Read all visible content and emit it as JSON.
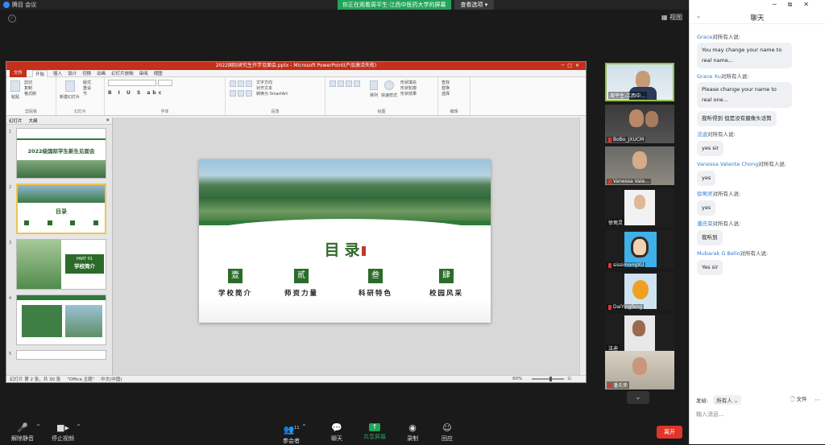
{
  "window": {
    "app_title": "腾目 会议",
    "share_notice": "你正在观看周平生-江西中医药大学的屏幕",
    "view_options": "查看选项",
    "view_label": "视图"
  },
  "ppt": {
    "title": "2022国际研究生开学见面会.pptx - Microsoft PowerPoint(产品激活失败)",
    "tabs": [
      "文件",
      "开始",
      "插入",
      "设计",
      "切换",
      "动画",
      "幻灯片放映",
      "审阅",
      "视图"
    ],
    "active_tab": "开始",
    "ribbon_groups": [
      "剪贴板",
      "幻灯片",
      "字体",
      "段落",
      "绘图",
      "编辑"
    ],
    "ribbon_labels": {
      "paste": "粘贴",
      "cut": "剪切",
      "copy": "复制",
      "format_painter": "格式刷",
      "new_slide": "新建幻灯片",
      "layout": "版式",
      "reset": "重设",
      "section": "节",
      "text_direction": "文字方向",
      "align_text": "对齐文本",
      "smartart": "转换为 SmartArt",
      "arrange": "排列",
      "quick_styles": "快速样式",
      "shape_fill": "形状填充",
      "shape_outline": "形状轮廓",
      "shape_effects": "形状效果",
      "find": "查找",
      "replace": "替换",
      "select": "选择"
    },
    "panel_tabs": [
      "幻灯片",
      "大纲"
    ],
    "thumbs": [
      {
        "num": "1",
        "title": "2022级国际学生新生见面会"
      },
      {
        "num": "2",
        "title": "目录"
      },
      {
        "num": "3",
        "title": "学校简介",
        "part": "PART 01"
      },
      {
        "num": "4",
        "title": ""
      },
      {
        "num": "5",
        "title": ""
      }
    ],
    "status": {
      "slide_pos": "幻灯片 第 2 张，共 30 张",
      "theme": "\"Office 主题\"",
      "lang": "中文(中国)",
      "zoom": "60%"
    },
    "slide": {
      "heading": "目录",
      "items": [
        {
          "num": "壹",
          "label": "学校简介"
        },
        {
          "num": "贰",
          "label": "师资力量"
        },
        {
          "num": "叁",
          "label": "科研特色"
        },
        {
          "num": "肆",
          "label": "校园风采"
        }
      ]
    }
  },
  "participants": [
    {
      "name": "周平生-江西中...",
      "muted": false,
      "active": true
    },
    {
      "name": "BoBo_JXUCM",
      "muted": true,
      "active": false
    },
    {
      "name": "Vanessa Vale...",
      "muted": true,
      "active": false
    },
    {
      "name": "徐莺灵",
      "muted": false,
      "active": false
    },
    {
      "name": "sissimomJXU",
      "muted": true,
      "active": false
    },
    {
      "name": "DaiYingfeng",
      "muted": true,
      "active": false
    },
    {
      "name": "法迪",
      "muted": false,
      "active": false
    },
    {
      "name": "潘氏荣",
      "muted": true,
      "active": false
    }
  ],
  "toolbar": {
    "unmute": "解除静音",
    "stop_video": "停止视频",
    "participants": "参会者",
    "participant_count": "11",
    "chat": "聊天",
    "share": "共享屏幕",
    "record": "录制",
    "reactions": "回应",
    "end": "离开"
  },
  "chat": {
    "title": "聊天",
    "messages": [
      {
        "sender": "Grace",
        "to": "对所有人说:",
        "text": "You may change your name to real name..."
      },
      {
        "sender": "Grace Xu",
        "to": "对所有人说:",
        "text": "Please change your name to real one..."
      },
      {
        "sender": "",
        "to": "",
        "text": "我听得到 但是没有摄像头话筒"
      },
      {
        "sender": "法迪",
        "to": "对所有人说:",
        "text": "yes sir"
      },
      {
        "sender": "Vanessa Valente Chong",
        "to": "对所有人说:",
        "text": "yes"
      },
      {
        "sender": "徐莺灵",
        "to": "对所有人说:",
        "text": "yes"
      },
      {
        "sender": "潘氏荣",
        "to": "对所有人说:",
        "text": "我听到"
      },
      {
        "sender": "Mubarak G Bello",
        "to": "对所有人说:",
        "text": "Yes sir"
      }
    ],
    "send_to_label": "发给:",
    "send_to_value": "所有人",
    "file_label": "文件",
    "input_placeholder": "输入消息..."
  },
  "colors": {
    "accent_green": "#23a45a",
    "end_red": "#e0352b",
    "ppt_red": "#c4301a",
    "chat_blue": "#2d7bd6"
  }
}
